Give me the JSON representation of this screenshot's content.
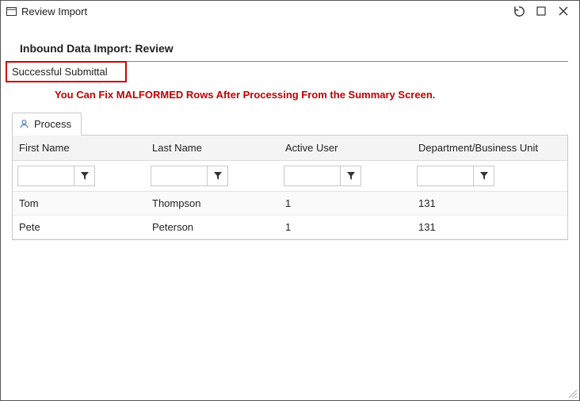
{
  "window": {
    "title": "Review Import"
  },
  "page": {
    "title": "Inbound Data Import: Review",
    "status": "Successful Submittal",
    "warning": "You Can Fix MALFORMED Rows After Processing From the Summary Screen."
  },
  "tabs": {
    "process": {
      "label": "Process"
    }
  },
  "grid": {
    "columns": {
      "first_name": "First Name",
      "last_name": "Last Name",
      "active_user": "Active User",
      "department": "Department/Business Unit"
    },
    "filters": {
      "first_name": "",
      "last_name": "",
      "active_user": "",
      "department": ""
    },
    "rows": [
      {
        "first_name": "Tom",
        "last_name": "Thompson",
        "active_user": "1",
        "department": "131"
      },
      {
        "first_name": "Pete",
        "last_name": "Peterson",
        "active_user": "1",
        "department": "131"
      }
    ]
  }
}
